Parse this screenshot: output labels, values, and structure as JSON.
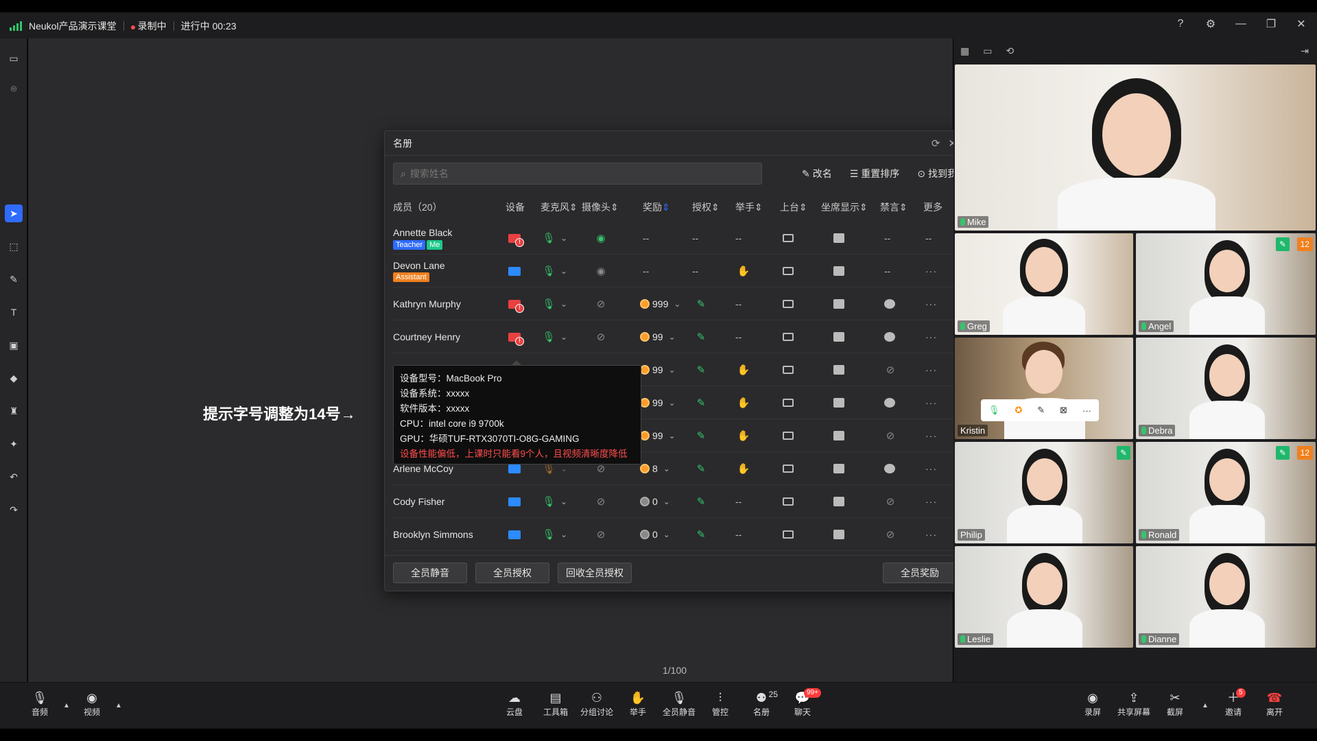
{
  "topbar": {
    "app_title": "Neukol产品演示课堂",
    "recording": "录制中",
    "progress": "进行中 00:23",
    "window_buttons": [
      "help-icon",
      "settings-icon",
      "minimize-icon",
      "restore-icon",
      "close-icon"
    ]
  },
  "stage": {
    "hint": "提示字号调整为14号→",
    "pager": "1/100"
  },
  "roster": {
    "title": "名册",
    "search_placeholder": "搜索姓名",
    "tools": {
      "rename": "改名",
      "reorder": "重置排序",
      "find_me": "找到我"
    },
    "columns": {
      "member": "成员（20）",
      "device": "设备",
      "mic": "麦克风",
      "camera": "摄像头",
      "reward": "奖励",
      "authorize": "授权",
      "hand": "举手",
      "stage": "上台",
      "seat": "坐席显示",
      "mute": "禁言",
      "more": "更多"
    },
    "rows": [
      {
        "name": "Annette Black",
        "tags": [
          "Teacher",
          "Me"
        ],
        "reward": "--",
        "auth": "--",
        "hand": "--",
        "mute": "--",
        "more": "--"
      },
      {
        "name": "Devon Lane",
        "tags": [
          "Assistant"
        ],
        "reward": "--",
        "auth": "--",
        "mute": "--",
        "more": "···"
      },
      {
        "name": "Kathryn Murphy",
        "reward": "999",
        "hand": "--",
        "more": "···"
      },
      {
        "name": "Courtney Henry",
        "reward": "99",
        "hand": "--",
        "more": "···"
      },
      {
        "name": "",
        "reward": "99",
        "more": "···"
      },
      {
        "name": "",
        "reward": "99",
        "more": "···"
      },
      {
        "name": "",
        "reward": "99",
        "more": "···"
      },
      {
        "name": "Arlene McCoy",
        "reward": "8",
        "more": "···"
      },
      {
        "name": "Cody Fisher",
        "reward": "0",
        "hand": "--",
        "more": "···"
      },
      {
        "name": "Brooklyn Simmons",
        "reward": "0",
        "hand": "--",
        "more": "···"
      }
    ],
    "footer": {
      "mute_all": "全员静音",
      "auth_all": "全员授权",
      "revoke_all": "回收全员授权",
      "reward_all": "全员奖励"
    }
  },
  "tooltip": {
    "model": "设备型号：MacBook Pro",
    "os": "设备系统：xxxxx",
    "sw": "软件版本：xxxxx",
    "cpu": "CPU：intel core i9 9700k",
    "gpu": "GPU：华硕TUF-RTX3070TI-O8G-GAMING",
    "warning": "设备性能偏低，上课时只能看9个人，且视频清晰度降低"
  },
  "videos": {
    "teacher": "Mike",
    "tiles": [
      "Greg",
      "Angel",
      "Kristin",
      "Debra",
      "Philip",
      "Ronald",
      "Leslie",
      "Dianne"
    ],
    "badge_count": "12"
  },
  "bottombar": {
    "audio": "音频",
    "video": "视频",
    "cloud": "云盘",
    "toolbox": "工具箱",
    "group": "分组讨论",
    "raise": "举手",
    "mute_all": "全员静音",
    "control": "管控",
    "roster": "名册",
    "roster_count": "25",
    "chat": "聊天",
    "chat_badge": "99+",
    "record": "录屏",
    "share": "共享屏幕",
    "screenshot": "截屏",
    "invite": "邀请",
    "invite_badge": "5",
    "leave": "离开"
  },
  "colors": {
    "accent": "#2f6bff",
    "green": "#35c46c",
    "orange": "#ff8a00",
    "danger": "#ff4d4d"
  }
}
